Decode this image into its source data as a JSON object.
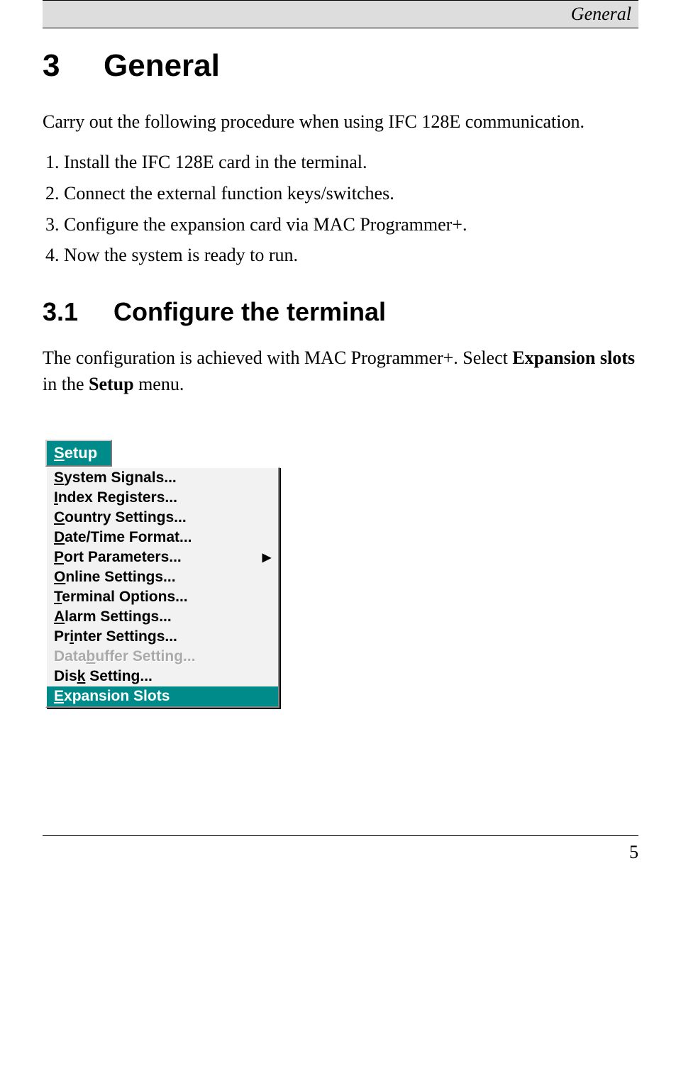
{
  "header": {
    "title": "General"
  },
  "section": {
    "number": "3",
    "title": "General"
  },
  "intro": "Carry out the following procedure when using IFC 128E communication.",
  "steps": [
    "Install the IFC 128E card in the terminal.",
    "Connect the external function keys/switches.",
    "Configure the expansion card via MAC Programmer+.",
    "Now the system is ready to run."
  ],
  "subsection": {
    "number": "3.1",
    "title": "Configure the terminal"
  },
  "sub_intro_1": "The configuration is achieved with MAC Programmer+. Select ",
  "sub_intro_bold1": "Expansion slots",
  "sub_intro_mid": " in the ",
  "sub_intro_bold2": "Setup",
  "sub_intro_2": " menu.",
  "menu": {
    "title_pre": "S",
    "title_rest": "etup",
    "items": [
      {
        "pre": "S",
        "rest": "ystem Signals...",
        "hasSub": false
      },
      {
        "pre": "I",
        "rest": "ndex Registers...",
        "hasSub": false
      },
      {
        "pre": "C",
        "rest": "ountry Settings...",
        "hasSub": false
      },
      {
        "pre": "D",
        "rest": "ate/Time Format...",
        "hasSub": false
      },
      {
        "pre": "P",
        "rest": "ort Parameters...",
        "hasSub": true
      },
      {
        "pre": "O",
        "rest": "nline Settings...",
        "hasSub": false
      },
      {
        "pre": "T",
        "rest": "erminal Options...",
        "hasSub": false
      },
      {
        "pre": "A",
        "rest": "larm Settings...",
        "hasSub": false
      },
      {
        "pre": "",
        "rest": "Pr",
        "mid_ul": "i",
        "tail": "nter Settings...",
        "hasSub": false
      },
      {
        "pre": "",
        "rest": "Data",
        "mid_ul": "b",
        "tail": "uffer Setting...",
        "hasSub": false,
        "disabled": true
      },
      {
        "pre": "",
        "rest": "Dis",
        "mid_ul": "k",
        "tail": " Setting...",
        "hasSub": false
      },
      {
        "pre": "E",
        "rest": "xpansion Slots",
        "hasSub": false,
        "highlight": true
      }
    ]
  },
  "page_number": "5"
}
